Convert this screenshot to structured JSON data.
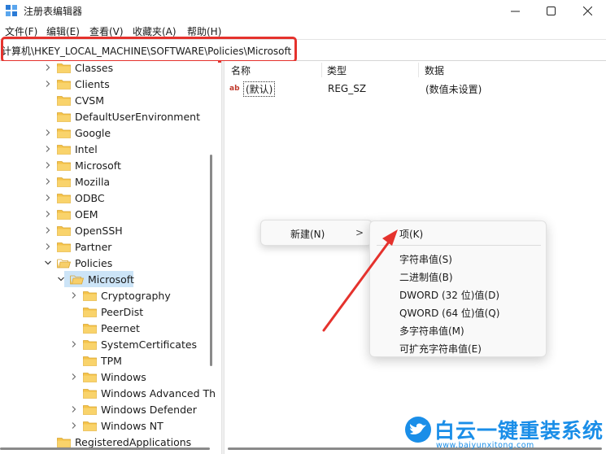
{
  "window": {
    "title": "注册表编辑器",
    "controls": [
      "minimize-icon",
      "maximize-icon",
      "close-icon"
    ]
  },
  "menu": {
    "items": [
      "文件(F)",
      "编辑(E)",
      "查看(V)",
      "收藏夹(A)",
      "帮助(H)"
    ]
  },
  "address": {
    "path": "计算机\\HKEY_LOCAL_MACHINE\\SOFTWARE\\Policies\\Microsoft"
  },
  "tree": {
    "items": [
      {
        "label": "Classes",
        "level": 1,
        "expand": "collapsed"
      },
      {
        "label": "Clients",
        "level": 1,
        "expand": "collapsed"
      },
      {
        "label": "CVSM",
        "level": 1,
        "expand": "none"
      },
      {
        "label": "DefaultUserEnvironment",
        "level": 1,
        "expand": "none"
      },
      {
        "label": "Google",
        "level": 1,
        "expand": "collapsed"
      },
      {
        "label": "Intel",
        "level": 1,
        "expand": "collapsed"
      },
      {
        "label": "Microsoft",
        "level": 1,
        "expand": "collapsed"
      },
      {
        "label": "Mozilla",
        "level": 1,
        "expand": "collapsed"
      },
      {
        "label": "ODBC",
        "level": 1,
        "expand": "collapsed"
      },
      {
        "label": "OEM",
        "level": 1,
        "expand": "collapsed"
      },
      {
        "label": "OpenSSH",
        "level": 1,
        "expand": "collapsed"
      },
      {
        "label": "Partner",
        "level": 1,
        "expand": "collapsed"
      },
      {
        "label": "Policies",
        "level": 1,
        "expand": "expanded"
      },
      {
        "label": "Microsoft",
        "level": 2,
        "expand": "expanded",
        "selected": true
      },
      {
        "label": "Cryptography",
        "level": 3,
        "expand": "collapsed"
      },
      {
        "label": "PeerDist",
        "level": 3,
        "expand": "none"
      },
      {
        "label": "Peernet",
        "level": 3,
        "expand": "none"
      },
      {
        "label": "SystemCertificates",
        "level": 3,
        "expand": "collapsed"
      },
      {
        "label": "TPM",
        "level": 3,
        "expand": "none"
      },
      {
        "label": "Windows",
        "level": 3,
        "expand": "collapsed"
      },
      {
        "label": "Windows Advanced Th",
        "level": 3,
        "expand": "none"
      },
      {
        "label": "Windows Defender",
        "level": 3,
        "expand": "collapsed"
      },
      {
        "label": "Windows NT",
        "level": 3,
        "expand": "collapsed"
      },
      {
        "label": "RegisteredApplications",
        "level": 1,
        "expand": "none"
      }
    ]
  },
  "list": {
    "columns": [
      "名称",
      "类型",
      "数据"
    ],
    "rows": [
      {
        "name": "(默认)",
        "type": "REG_SZ",
        "data": "(数值未设置)",
        "icon": "ab-string-icon"
      }
    ]
  },
  "context_menu": {
    "new_label": "新建(N)",
    "arrow": ">",
    "submenu": [
      "项(K)",
      "字符串值(S)",
      "二进制值(B)",
      "DWORD (32 位)值(D)",
      "QWORD (64 位)值(Q)",
      "多字符串值(M)",
      "可扩充字符串值(E)"
    ]
  },
  "watermark": {
    "brand": "白云一键重装系统",
    "url": "www.baiyunxitong.com"
  },
  "colors": {
    "highlight_red": "#e5322d",
    "selection": "#cce4f7",
    "folder_yellow": "#f5c34a",
    "brand_blue": "#1a8ee8"
  }
}
